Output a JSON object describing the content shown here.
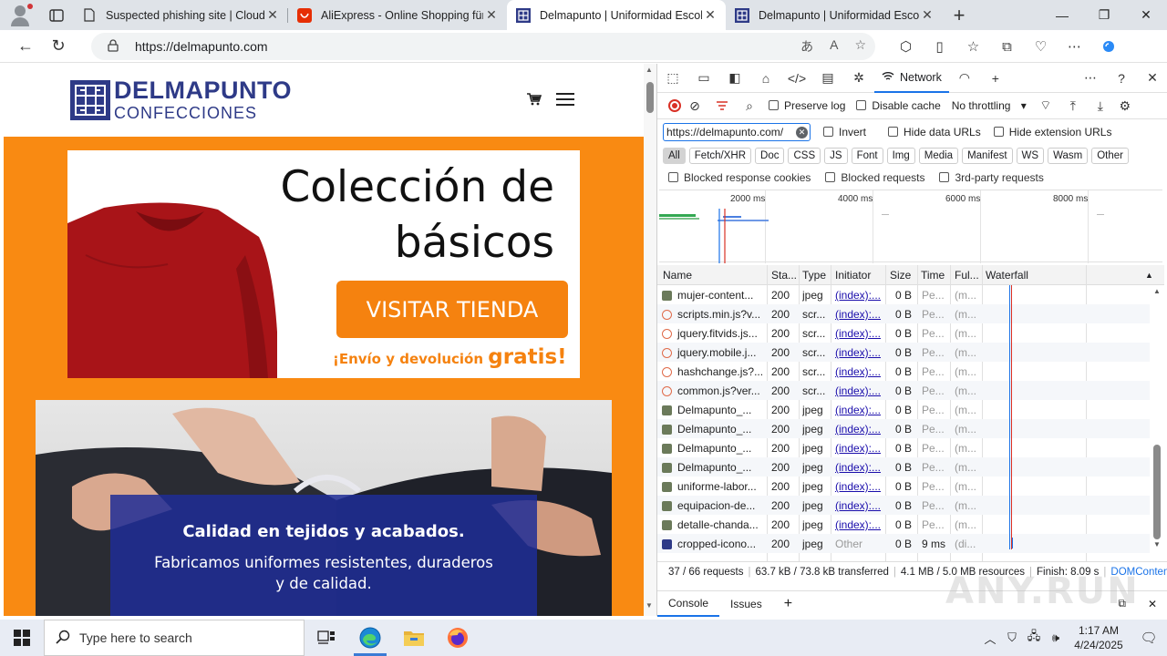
{
  "browser": {
    "tabs": [
      {
        "title": "Suspected phishing site | Cloudfl",
        "icon": "document-icon"
      },
      {
        "title": "AliExpress - Online Shopping für",
        "icon": "aliexpress-icon"
      },
      {
        "title": "Delmapunto | Uniformidad Escol",
        "icon": "delmapunto-icon",
        "active": true
      },
      {
        "title": "Delmapunto | Uniformidad Escol",
        "icon": "delmapunto-icon"
      }
    ],
    "url": "https://delmapunto.com"
  },
  "site": {
    "logo_name": "DELMAPUNTO",
    "logo_sub": "CONFECCIONES",
    "banner_line1": "Colección de",
    "banner_line2": "básicos",
    "shop_button": "VISITAR TIENDA",
    "shipping_prefix": "¡Envío y devolución ",
    "shipping_bold": "gratis!",
    "quality_title": "Calidad en tejidos y acabados.",
    "quality_line1": "Fabricamos uniformes resistentes, duraderos",
    "quality_line2": "y de calidad.",
    "colors": {
      "brand": "#2e3a87",
      "accent": "#f98a12"
    }
  },
  "devtools": {
    "panel_tab": "Network",
    "preserve_log": "Preserve log",
    "disable_cache": "Disable cache",
    "throttling": "No throttling",
    "filter_value": "https://delmapunto.com/",
    "invert": "Invert",
    "hide_data_urls": "Hide data URLs",
    "hide_extension_urls": "Hide extension URLs",
    "type_filters": [
      "All",
      "Fetch/XHR",
      "Doc",
      "CSS",
      "JS",
      "Font",
      "Img",
      "Media",
      "Manifest",
      "WS",
      "Wasm",
      "Other"
    ],
    "blocked_response_cookies": "Blocked response cookies",
    "blocked_requests": "Blocked requests",
    "third_party": "3rd-party requests",
    "overview_labels": [
      "2000 ms",
      "4000 ms",
      "6000 ms",
      "8000 ms"
    ],
    "columns": [
      "Name",
      "Sta...",
      "Type",
      "Initiator",
      "Size",
      "Time",
      "Ful...",
      "Waterfall"
    ],
    "rows": [
      {
        "name": "mujer-content...",
        "status": "200",
        "type": "jpeg",
        "initiator": "(index):...",
        "size": "0 B",
        "time": "Pe...",
        "full": "(m...",
        "icon": "image"
      },
      {
        "name": "scripts.min.js?v...",
        "status": "200",
        "type": "scr...",
        "initiator": "(index):...",
        "size": "0 B",
        "time": "Pe...",
        "full": "(m...",
        "icon": "script"
      },
      {
        "name": "jquery.fitvids.js...",
        "status": "200",
        "type": "scr...",
        "initiator": "(index):...",
        "size": "0 B",
        "time": "Pe...",
        "full": "(m...",
        "icon": "script"
      },
      {
        "name": "jquery.mobile.j...",
        "status": "200",
        "type": "scr...",
        "initiator": "(index):...",
        "size": "0 B",
        "time": "Pe...",
        "full": "(m...",
        "icon": "script"
      },
      {
        "name": "hashchange.js?...",
        "status": "200",
        "type": "scr...",
        "initiator": "(index):...",
        "size": "0 B",
        "time": "Pe...",
        "full": "(m...",
        "icon": "script"
      },
      {
        "name": "common.js?ver...",
        "status": "200",
        "type": "scr...",
        "initiator": "(index):...",
        "size": "0 B",
        "time": "Pe...",
        "full": "(m...",
        "icon": "script"
      },
      {
        "name": "Delmapunto_...",
        "status": "200",
        "type": "jpeg",
        "initiator": "(index):...",
        "size": "0 B",
        "time": "Pe...",
        "full": "(m...",
        "icon": "image"
      },
      {
        "name": "Delmapunto_...",
        "status": "200",
        "type": "jpeg",
        "initiator": "(index):...",
        "size": "0 B",
        "time": "Pe...",
        "full": "(m...",
        "icon": "image"
      },
      {
        "name": "Delmapunto_...",
        "status": "200",
        "type": "jpeg",
        "initiator": "(index):...",
        "size": "0 B",
        "time": "Pe...",
        "full": "(m...",
        "icon": "image"
      },
      {
        "name": "Delmapunto_...",
        "status": "200",
        "type": "jpeg",
        "initiator": "(index):...",
        "size": "0 B",
        "time": "Pe...",
        "full": "(m...",
        "icon": "image"
      },
      {
        "name": "uniforme-labor...",
        "status": "200",
        "type": "jpeg",
        "initiator": "(index):...",
        "size": "0 B",
        "time": "Pe...",
        "full": "(m...",
        "icon": "image"
      },
      {
        "name": "equipacion-de...",
        "status": "200",
        "type": "jpeg",
        "initiator": "(index):...",
        "size": "0 B",
        "time": "Pe...",
        "full": "(m...",
        "icon": "image"
      },
      {
        "name": "detalle-chanda...",
        "status": "200",
        "type": "jpeg",
        "initiator": "(index):...",
        "size": "0 B",
        "time": "Pe...",
        "full": "(m...",
        "icon": "image"
      },
      {
        "name": "cropped-icono...",
        "status": "200",
        "type": "jpeg",
        "initiator": "Other",
        "size": "0 B",
        "time": "9 ms",
        "full": "(di...",
        "icon": "favicon"
      }
    ],
    "status_bar": {
      "requests": "37 / 66 requests",
      "transferred": "63.7 kB / 73.8 kB transferred",
      "resources": "4.1 MB / 5.0 MB resources",
      "finish": "Finish: 8.09 s",
      "dcl": "DOMContentLoa"
    },
    "drawer_tabs": [
      "Console",
      "Issues"
    ]
  },
  "watermark": "ANY.RUN",
  "taskbar": {
    "search_placeholder": "Type here to search",
    "time": "1:17 AM",
    "date": "4/24/2025"
  }
}
